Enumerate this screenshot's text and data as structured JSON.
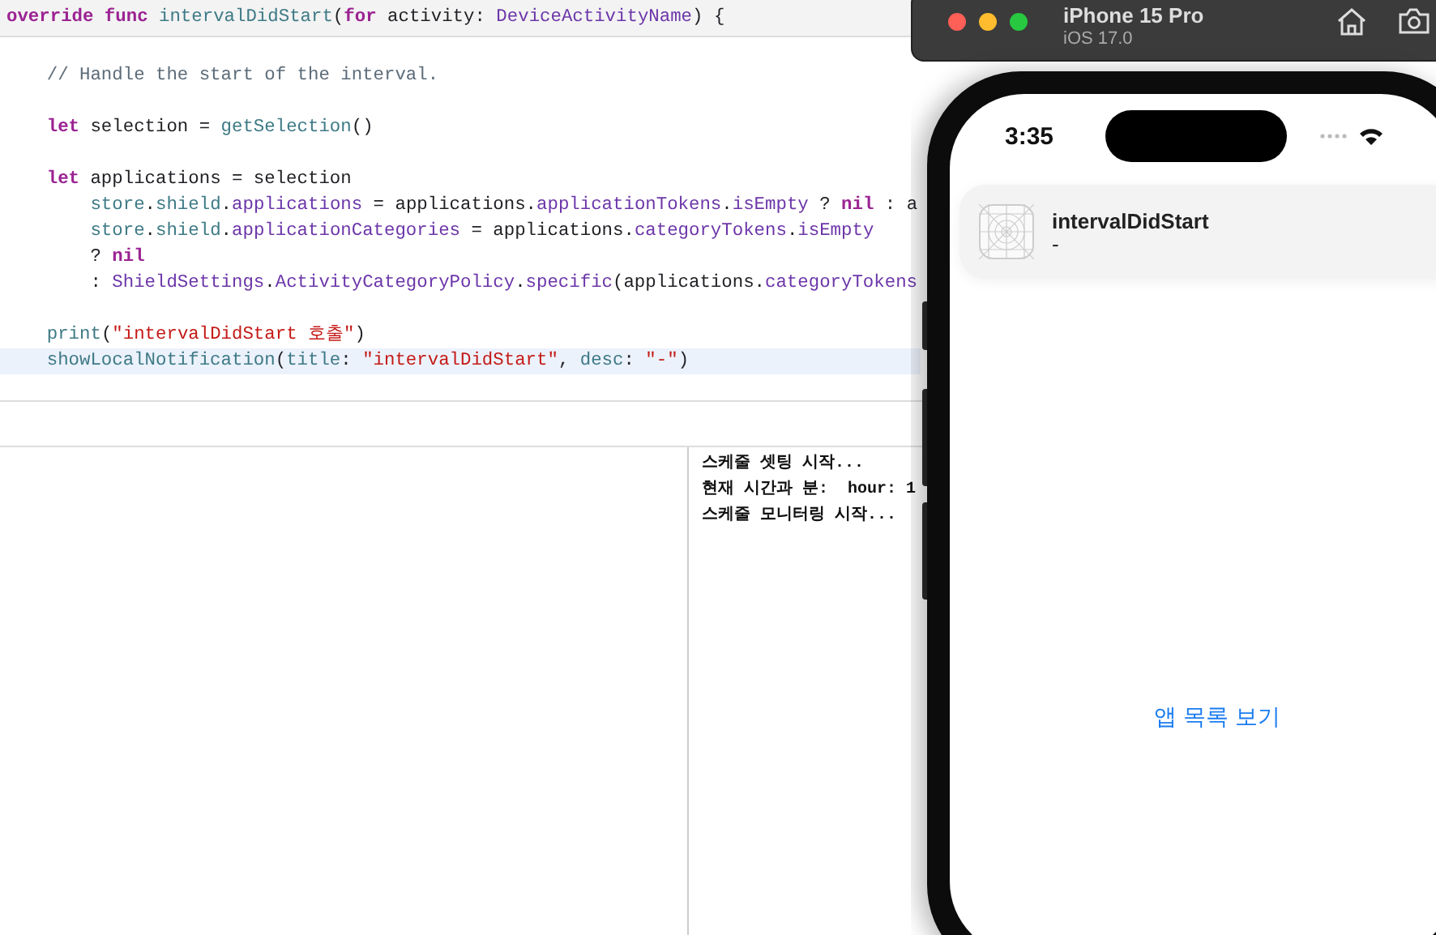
{
  "editor": {
    "header": [
      {
        "text": "override func",
        "kind": "keyword"
      },
      {
        "text": "intervalDidStart",
        "kind": "function"
      },
      {
        "text": "(",
        "kind": "plain"
      },
      {
        "text": "for",
        "kind": "keyword"
      },
      {
        "text": "activity:",
        "kind": "plain"
      },
      {
        "text": "DeviceActivityName",
        "kind": "type"
      },
      {
        "text": ") {",
        "kind": "plain"
      }
    ],
    "lines": [
      {
        "highlighted": false,
        "gap_before": true,
        "tokens": [
          {
            "text": "    // Handle the start of the interval.",
            "kind": "comment"
          }
        ]
      },
      {
        "highlighted": false,
        "gap_before": true,
        "tokens": [
          {
            "text": "    let",
            "kind": "keyword"
          },
          {
            "text": " selection = ",
            "kind": "plain"
          },
          {
            "text": "getSelection",
            "kind": "function"
          },
          {
            "text": "()",
            "kind": "plain"
          }
        ]
      },
      {
        "highlighted": false,
        "gap_before": true,
        "tokens": [
          {
            "text": "    let",
            "kind": "keyword"
          },
          {
            "text": " applications = selection",
            "kind": "plain"
          }
        ]
      },
      {
        "highlighted": false,
        "gap_before": false,
        "tokens": [
          {
            "text": "        store",
            "kind": "function"
          },
          {
            "text": ".",
            "kind": "plain"
          },
          {
            "text": "shield",
            "kind": "function"
          },
          {
            "text": ".",
            "kind": "plain"
          },
          {
            "text": "applications",
            "kind": "type"
          },
          {
            "text": " = applications.",
            "kind": "plain"
          },
          {
            "text": "applicationTokens",
            "kind": "type"
          },
          {
            "text": ".",
            "kind": "plain"
          },
          {
            "text": "isEmpty",
            "kind": "type"
          },
          {
            "text": " ? ",
            "kind": "plain"
          },
          {
            "text": "nil",
            "kind": "keyword"
          },
          {
            "text": " : a",
            "kind": "plain"
          }
        ]
      },
      {
        "highlighted": false,
        "gap_before": false,
        "tokens": [
          {
            "text": "        store",
            "kind": "function"
          },
          {
            "text": ".",
            "kind": "plain"
          },
          {
            "text": "shield",
            "kind": "function"
          },
          {
            "text": ".",
            "kind": "plain"
          },
          {
            "text": "applicationCategories",
            "kind": "type"
          },
          {
            "text": " = applications.",
            "kind": "plain"
          },
          {
            "text": "categoryTokens",
            "kind": "type"
          },
          {
            "text": ".",
            "kind": "plain"
          },
          {
            "text": "isEmpty",
            "kind": "type"
          }
        ]
      },
      {
        "highlighted": false,
        "gap_before": false,
        "tokens": [
          {
            "text": "        ? ",
            "kind": "plain"
          },
          {
            "text": "nil",
            "kind": "keyword"
          }
        ]
      },
      {
        "highlighted": false,
        "gap_before": false,
        "tokens": [
          {
            "text": "        : ",
            "kind": "plain"
          },
          {
            "text": "ShieldSettings",
            "kind": "type"
          },
          {
            "text": ".",
            "kind": "plain"
          },
          {
            "text": "ActivityCategoryPolicy",
            "kind": "type"
          },
          {
            "text": ".",
            "kind": "plain"
          },
          {
            "text": "specific",
            "kind": "type"
          },
          {
            "text": "(applications.",
            "kind": "plain"
          },
          {
            "text": "categoryTokens",
            "kind": "type"
          }
        ]
      },
      {
        "highlighted": false,
        "gap_before": true,
        "tokens": [
          {
            "text": "    print",
            "kind": "function"
          },
          {
            "text": "(",
            "kind": "plain"
          },
          {
            "text": "\"intervalDidStart 호출\"",
            "kind": "string"
          },
          {
            "text": ")",
            "kind": "plain"
          }
        ]
      },
      {
        "highlighted": true,
        "gap_before": false,
        "tokens": [
          {
            "text": "    showLocalNotification",
            "kind": "function"
          },
          {
            "text": "(",
            "kind": "plain"
          },
          {
            "text": "title",
            "kind": "function"
          },
          {
            "text": ": ",
            "kind": "plain"
          },
          {
            "text": "\"intervalDidStart\"",
            "kind": "string"
          },
          {
            "text": ", ",
            "kind": "plain"
          },
          {
            "text": "desc",
            "kind": "function"
          },
          {
            "text": ": ",
            "kind": "plain"
          },
          {
            "text": "\"-\"",
            "kind": "string"
          },
          {
            "text": ")",
            "kind": "plain"
          }
        ]
      }
    ]
  },
  "console": {
    "lines": [
      "스케줄 셋팅 시작...",
      "현재 시간과 분:  hour: 1",
      "스케줄 모니터링 시작..."
    ]
  },
  "simulator": {
    "title": "iPhone 15 Pro",
    "subtitle": "iOS 17.0",
    "phone": {
      "time": "3:35",
      "notification": {
        "title": "intervalDidStart",
        "body": "-"
      },
      "button": "앱 목록 보기"
    }
  }
}
